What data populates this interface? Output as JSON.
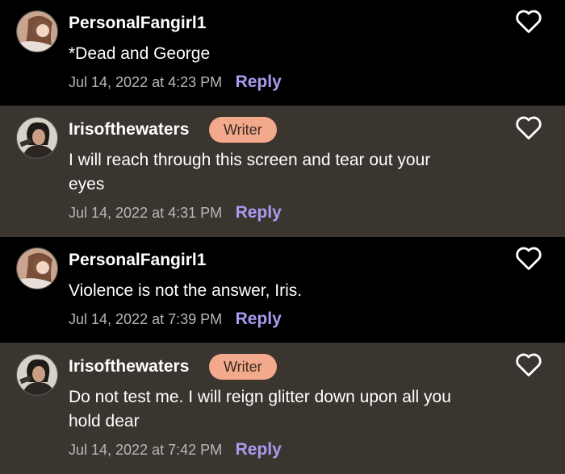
{
  "comments": [
    {
      "username": "PersonalFangirl1",
      "role": "reader",
      "badge": "",
      "text": "*Dead and George",
      "timestamp": "Jul 14, 2022 at 4:23 PM",
      "reply_label": "Reply",
      "avatar": "personalfangirl-avatar",
      "like_icon": "heart-outline-icon"
    },
    {
      "username": "Irisofthewaters",
      "role": "writer",
      "badge": "Writer",
      "text": "I will reach through this screen and tear out your eyes",
      "timestamp": "Jul 14, 2022 at 4:31 PM",
      "reply_label": "Reply",
      "avatar": "irisofthewaters-avatar",
      "like_icon": "heart-outline-icon"
    },
    {
      "username": "PersonalFangirl1",
      "role": "reader",
      "badge": "",
      "text": "Violence is not the answer, Iris.",
      "timestamp": "Jul 14, 2022 at 7:39 PM",
      "reply_label": "Reply",
      "avatar": "personalfangirl-avatar",
      "like_icon": "heart-outline-icon"
    },
    {
      "username": "Irisofthewaters",
      "role": "writer",
      "badge": "Writer",
      "text": "Do not test me. I will reign glitter down upon all you hold dear",
      "timestamp": "Jul 14, 2022 at 7:42 PM",
      "reply_label": "Reply",
      "avatar": "irisofthewaters-avatar",
      "like_icon": "heart-outline-icon"
    }
  ],
  "colors": {
    "reader_bg": "#000000",
    "writer_bg": "#3b3530",
    "badge_bg": "#f3a98c",
    "reply": "#a89cf0",
    "timestamp": "#b8b8b8"
  }
}
